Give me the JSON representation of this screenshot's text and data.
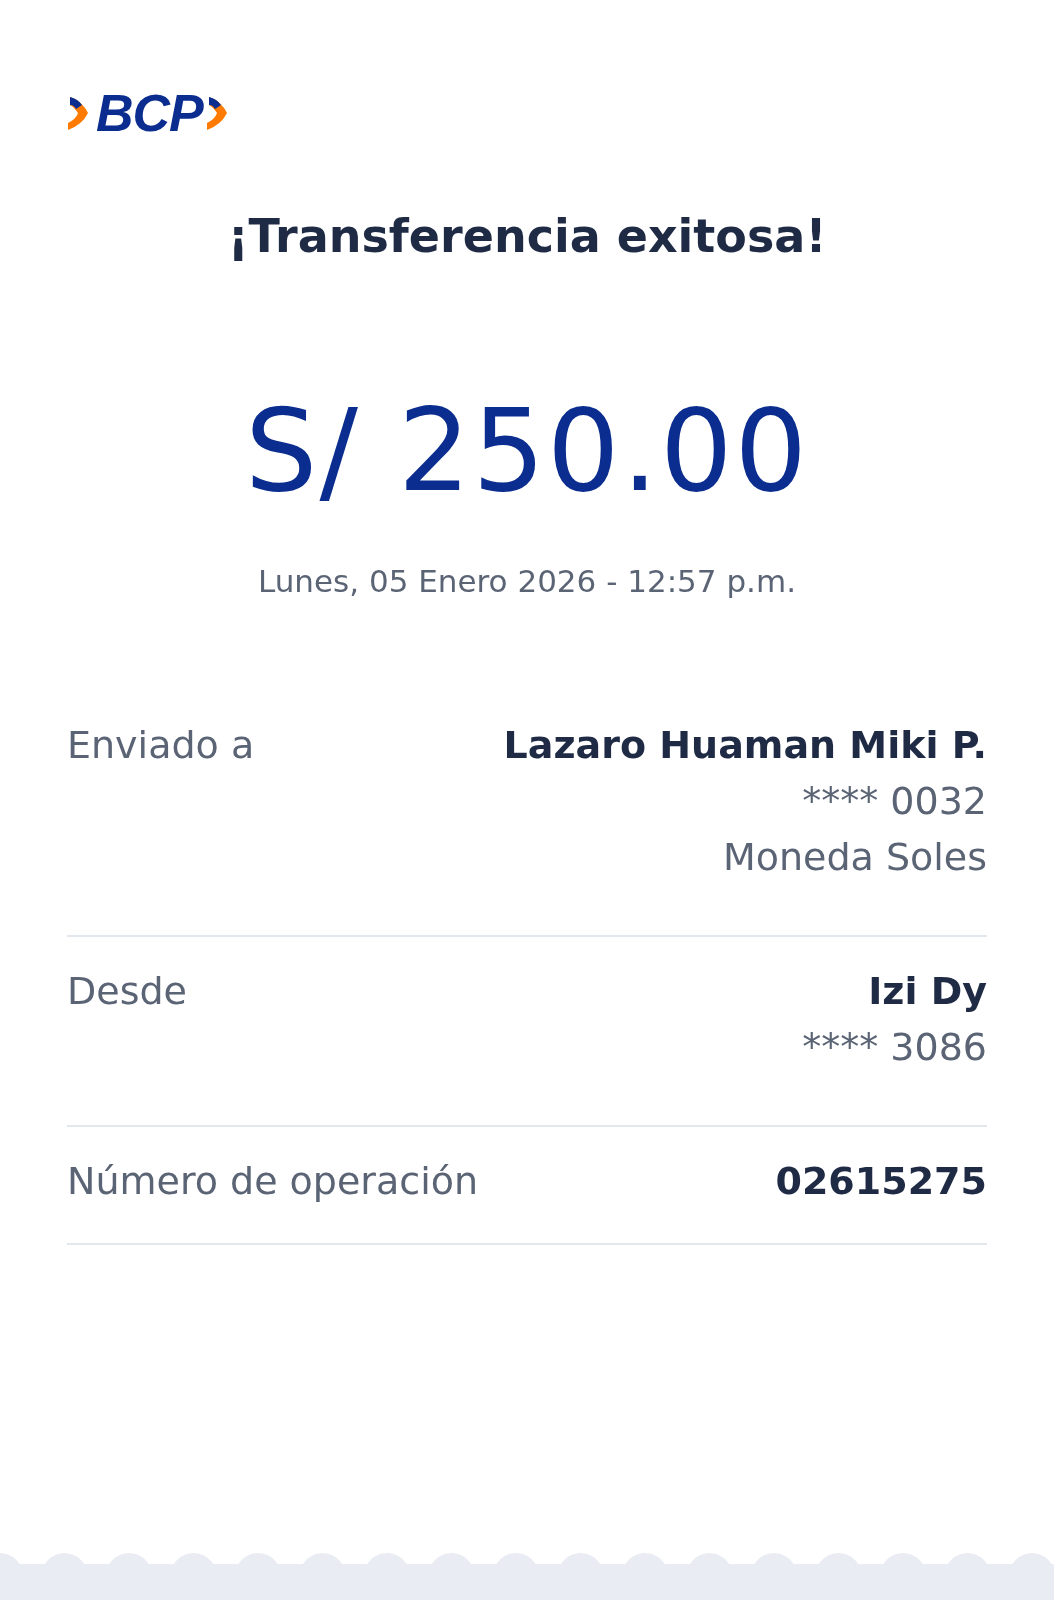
{
  "logo": {
    "text": "BCP"
  },
  "title": "¡Transferencia exitosa!",
  "amount": "S/ 250.00",
  "date": "Lunes, 05 Enero 2026 - 12:57 p.m.",
  "details": [
    {
      "label": "Enviado a",
      "lines": [
        {
          "kind": "primary",
          "text": "Lazaro Huaman Miki P."
        },
        {
          "kind": "secondary",
          "text": "**** 0032"
        },
        {
          "kind": "secondary",
          "text": "Moneda Soles"
        }
      ]
    },
    {
      "label": "Desde",
      "lines": [
        {
          "kind": "primary",
          "text": "Izi Dy"
        },
        {
          "kind": "secondary",
          "text": "**** 3086"
        }
      ]
    },
    {
      "label": "Número de operación",
      "lines": [
        {
          "kind": "primary",
          "text": "02615275"
        }
      ]
    }
  ]
}
